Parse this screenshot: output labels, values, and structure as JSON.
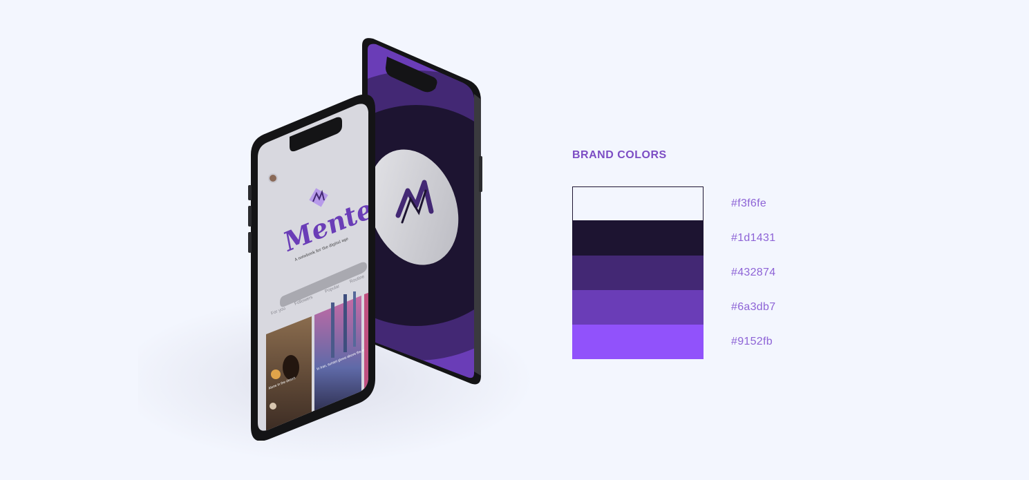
{
  "mockup": {
    "app_name": "Mente",
    "tagline": "A notebook for the digital age",
    "tabs": [
      "For you",
      "Followers",
      "Popular",
      "Routine"
    ],
    "card_1": {
      "title": "Alone in the desert"
    },
    "card_2": {
      "title": "In Iran, sunset glows above the mosque"
    }
  },
  "palette": {
    "title": "BRAND COLORS",
    "colors": [
      {
        "hex": "#f3f6fe",
        "label": "#f3f6fe"
      },
      {
        "hex": "#1d1431",
        "label": "#1d1431"
      },
      {
        "hex": "#432874",
        "label": "#432874"
      },
      {
        "hex": "#6a3db7",
        "label": "#6a3db7"
      },
      {
        "hex": "#9152fb",
        "label": "#9152fb"
      }
    ]
  }
}
